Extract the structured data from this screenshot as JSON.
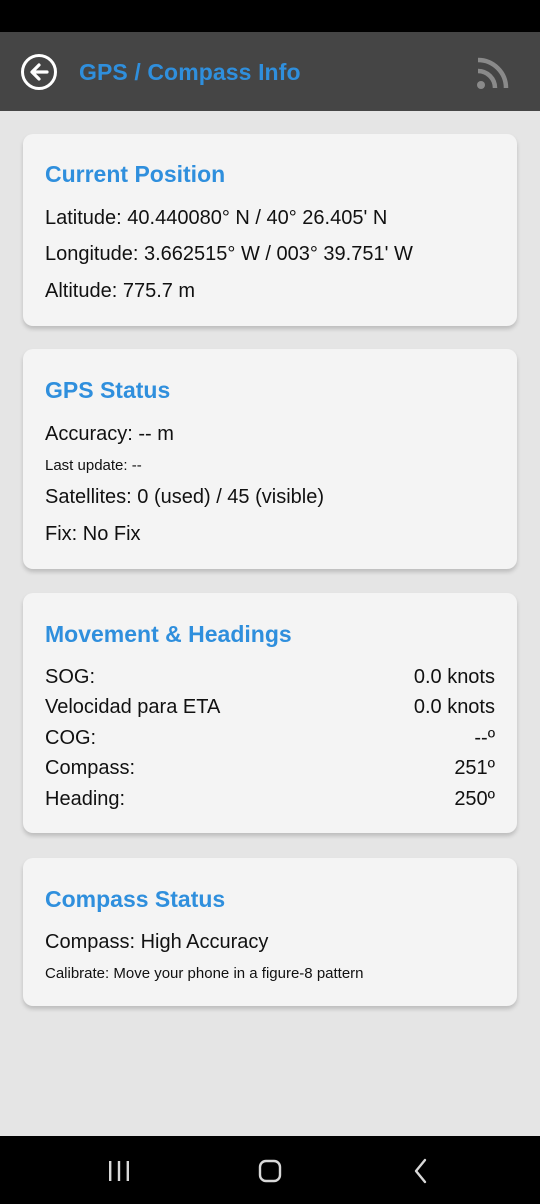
{
  "app": {
    "title": "GPS / Compass Info"
  },
  "colors": {
    "accent": "#2f8fdd",
    "appbar": "#454545",
    "card": "#f4f4f4",
    "background": "#e5e5e5"
  },
  "icons": {
    "back": "back-arrow-circle-icon",
    "share": "rss-icon",
    "nav_recents": "recents-icon",
    "nav_home": "home-icon",
    "nav_back": "back-chevron-icon"
  },
  "current_position": {
    "title": "Current Position",
    "latitude": "Latitude: 40.440080° N / 40° 26.405' N",
    "longitude": "Longitude: 3.662515° W / 003° 39.751' W",
    "altitude": "Altitude: 775.7 m"
  },
  "gps_status": {
    "title": "GPS Status",
    "accuracy": "Accuracy: -- m",
    "last_update": "Last update: --",
    "satellites": "Satellites: 0 (used) / 45 (visible)",
    "fix": "Fix: No Fix"
  },
  "movement": {
    "title": "Movement & Headings",
    "rows": [
      {
        "label": "SOG:",
        "value": "0.0 knots"
      },
      {
        "label": "Velocidad para ETA",
        "value": "0.0 knots"
      },
      {
        "label": "COG:",
        "value": "--º"
      },
      {
        "label": "Compass:",
        "value": "251º"
      },
      {
        "label": "Heading:",
        "value": "250º"
      }
    ]
  },
  "compass_status": {
    "title": "Compass Status",
    "compass": "Compass: High Accuracy",
    "calibrate": "Calibrate: Move your phone in a figure-8 pattern"
  }
}
